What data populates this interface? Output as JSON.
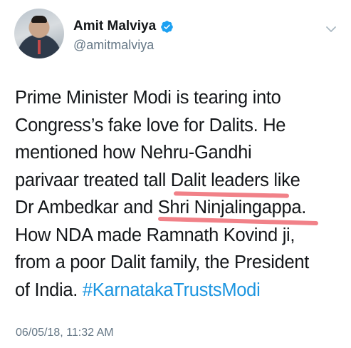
{
  "author": {
    "display_name": "Amit Malviya",
    "handle": "@amitmalviya",
    "verified": true,
    "avatar_icon": "profile-photo"
  },
  "tweet": {
    "lines": [
      "Prime Minister Modi is tearing into",
      "Congress’s fake love for Dalits. He",
      "mentioned how Nehru-Gandhi",
      "parivaar treated tall Dalit leaders like",
      "Dr Ambedkar and Shri Ninjalingappa.",
      "How NDA made Ramnath Kovind ji,",
      "from a poor Dalit family, the President",
      "of India."
    ],
    "hashtag": "#KarnatakaTrustsModi",
    "timestamp": "06/05/18, 11:32 AM"
  },
  "highlights": [
    "Dalit leaders",
    "Shri Ninjalingappa"
  ],
  "colors": {
    "text": "#14171a",
    "secondary": "#657786",
    "link": "#1b95e0",
    "verified": "#1da1f2",
    "highlight_marker": "#ee6b73"
  },
  "icons": {
    "verified": "verified-badge-icon",
    "menu": "chevron-down-icon"
  }
}
